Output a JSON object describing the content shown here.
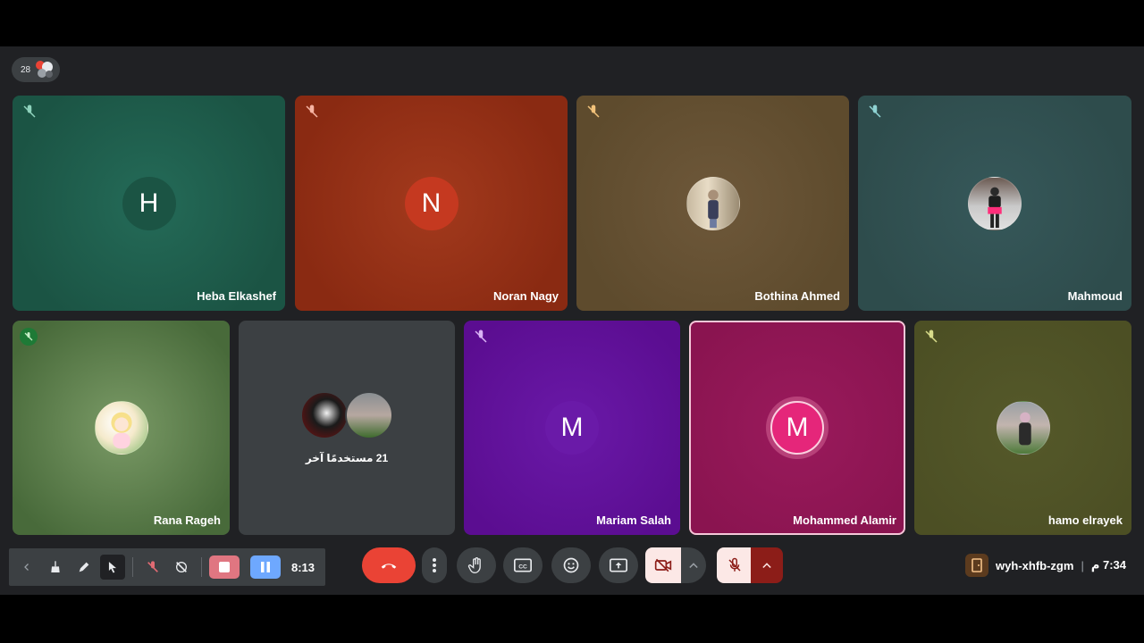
{
  "participant_count": "28",
  "tiles": [
    {
      "name": "Heba Elkashef",
      "initial": "H",
      "bg": "#1d5b4b",
      "avatar_bg": "#1b5444"
    },
    {
      "name": "Noran Nagy",
      "initial": "N",
      "bg": "#8a2a12",
      "avatar_bg": "#c53920"
    },
    {
      "name": "Bothina Ahmed",
      "initial": "",
      "bg": "#5e4b2d"
    },
    {
      "name": "Mahmoud",
      "initial": "",
      "bg": "#2e4c4c"
    },
    {
      "name": "Rana Rageh",
      "initial": "",
      "bg": "#486a3a"
    },
    {
      "name": "",
      "initial": "",
      "bg": "#3c4043"
    },
    {
      "name": "Mariam Salah",
      "initial": "M",
      "bg": "#5b0d91",
      "avatar_bg": "#6a1aa8"
    },
    {
      "name": "Mohammed Alamir",
      "initial": "M",
      "bg": "#8a1450",
      "avatar_bg": "#e5267a"
    },
    {
      "name": "hamo elrayek",
      "initial": "",
      "bg": "#4c4f24"
    }
  ],
  "others_label": "21 مستخدمًا آخر",
  "annotation": {
    "timer": "8:13"
  },
  "meeting": {
    "code": "wyh-xhfb-zgm",
    "time": "7:34 م"
  },
  "icons": {
    "mic_off": "mic-off-icon",
    "end_call": "phone-hangup-icon",
    "more": "more-vert-icon",
    "hand": "raise-hand-icon",
    "captions": "closed-captions-icon",
    "emoji": "emoji-icon",
    "present": "present-screen-icon",
    "camera_off": "videocam-off-icon",
    "chevron_up": "chevron-up-icon",
    "door": "exit-door-icon"
  },
  "colors": {
    "stage": "#202124",
    "end_call": "#ea4335",
    "speaking_outline": "#f4c7d8"
  }
}
